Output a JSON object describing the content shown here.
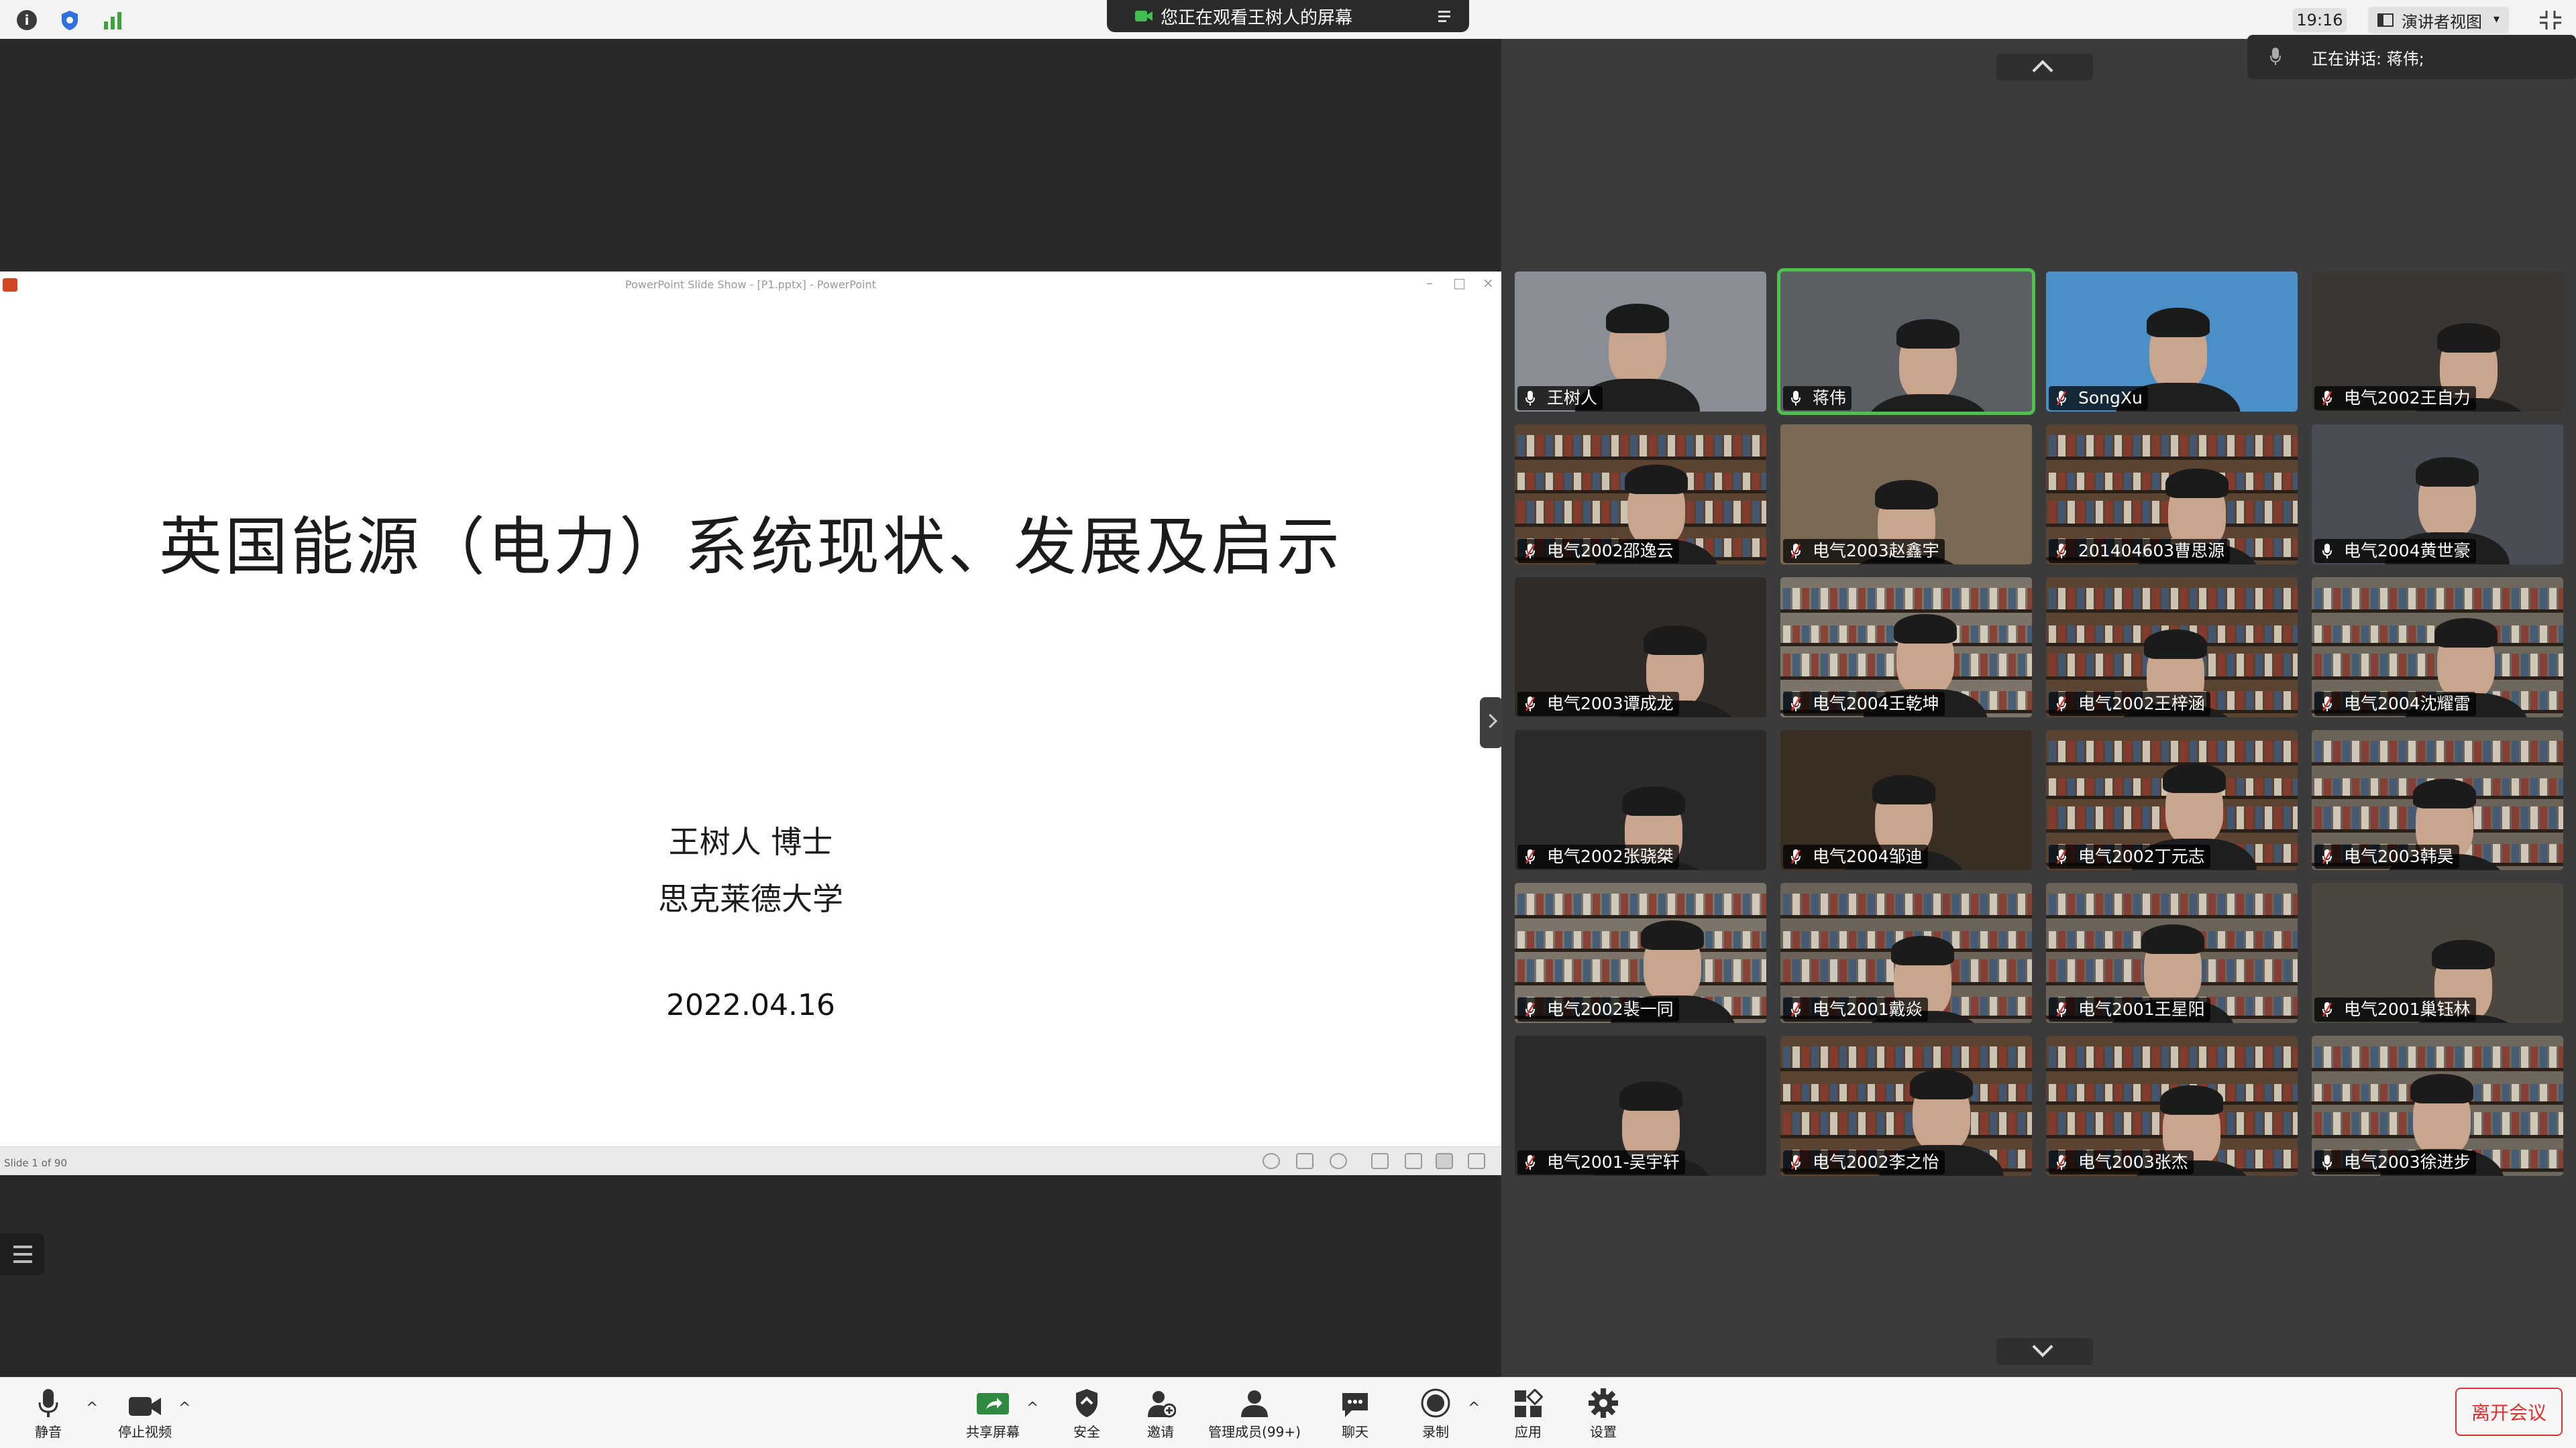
{
  "topbar": {
    "banner_text": "您正在观看王树人的屏幕",
    "clock": "19:16",
    "view_label": "演讲者视图"
  },
  "slide": {
    "window_title": "PowerPoint Slide Show - [P1.pptx] - PowerPoint",
    "title": "英国能源（电力）系统现状、发展及启示",
    "author": "王树人 博士",
    "university": "思克莱德大学",
    "date": "2022.04.16",
    "counter": "Slide 1 of 90"
  },
  "speaking": {
    "text": "正在讲话: 蒋伟;"
  },
  "participants": [
    {
      "name": "王树人",
      "muted": false,
      "active": false
    },
    {
      "name": "蒋伟",
      "muted": false,
      "active": true
    },
    {
      "name": "SongXu",
      "muted": true,
      "active": false
    },
    {
      "name": "电气2002王自力",
      "muted": true,
      "active": false
    },
    {
      "name": "电气2002邵逸云",
      "muted": true,
      "active": false
    },
    {
      "name": "电气2003赵鑫宇",
      "muted": true,
      "active": false
    },
    {
      "name": "201404603曹思源",
      "muted": true,
      "active": false
    },
    {
      "name": "电气2004黄世豪",
      "muted": false,
      "active": false
    },
    {
      "name": "电气2003谭成龙",
      "muted": true,
      "active": false
    },
    {
      "name": "电气2004王乾坤",
      "muted": true,
      "active": false
    },
    {
      "name": "电气2002王梓涵",
      "muted": true,
      "active": false
    },
    {
      "name": "电气2004沈耀雷",
      "muted": true,
      "active": false
    },
    {
      "name": "电气2002张骁桀",
      "muted": true,
      "active": false
    },
    {
      "name": "电气2004邹迪",
      "muted": true,
      "active": false
    },
    {
      "name": "电气2002丁元志",
      "muted": true,
      "active": false
    },
    {
      "name": "电气2003韩昊",
      "muted": true,
      "active": false
    },
    {
      "name": "电气2002裴一同",
      "muted": true,
      "active": false
    },
    {
      "name": "电气2001戴焱",
      "muted": true,
      "active": false
    },
    {
      "name": "电气2001王星阳",
      "muted": true,
      "active": false
    },
    {
      "name": "电气2001巢钰林",
      "muted": true,
      "active": false
    },
    {
      "name": "电气2001-吴宇轩",
      "muted": true,
      "active": false
    },
    {
      "name": "电气2002李之怡",
      "muted": true,
      "active": false
    },
    {
      "name": "电气2003张杰",
      "muted": true,
      "active": false
    },
    {
      "name": "电气2003徐进步",
      "muted": false,
      "active": false
    }
  ],
  "toolbar": {
    "mute": "静音",
    "stop_video": "停止视频",
    "share_screen": "共享屏幕",
    "security": "安全",
    "invite": "邀请",
    "participants": "管理成员(99+)",
    "chat": "聊天",
    "record": "录制",
    "apps": "应用",
    "settings": "设置",
    "leave": "离开会议"
  },
  "colors": {
    "active_speaker": "#4fbf4f",
    "leave": "#e03030",
    "share_green": "#2d8a3e"
  }
}
